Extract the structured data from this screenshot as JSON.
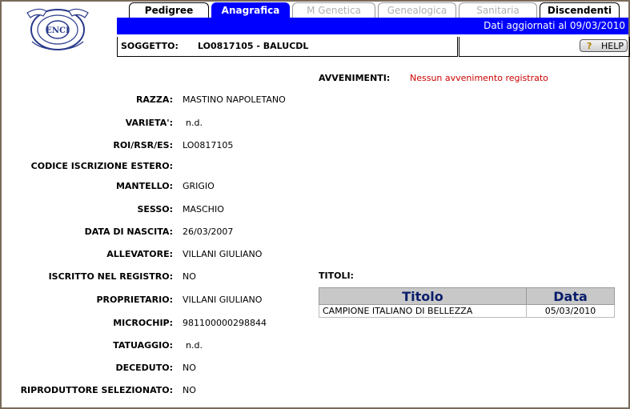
{
  "tabs": [
    {
      "label": "Pedigree",
      "state": "normal"
    },
    {
      "label": "Anagrafica",
      "state": "active"
    },
    {
      "label": "M Genetica",
      "state": "disabled"
    },
    {
      "label": "Genealogica",
      "state": "disabled"
    },
    {
      "label": "Sanitaria",
      "state": "disabled"
    },
    {
      "label": "Discendenti",
      "state": "normal"
    }
  ],
  "header": {
    "updated": "Dati aggiornati al 09/03/2010",
    "subject_label": "SOGGETTO:",
    "subject_value": "LO0817105 - BALUCDL",
    "help_label": "HELP",
    "help_icon": "question-icon"
  },
  "fields": [
    {
      "label": "RAZZA:",
      "value": "MASTINO NAPOLETANO"
    },
    {
      "label": "VARIETA':",
      "value": "n.d."
    },
    {
      "label": "ROI/RSR/ES:",
      "value": "LO0817105"
    },
    {
      "label": "CODICE ISCRIZIONE ESTERO:",
      "value": ""
    },
    {
      "label": "MANTELLO:",
      "value": "GRIGIO"
    },
    {
      "label": "SESSO:",
      "value": "MASCHIO"
    },
    {
      "label": "DATA DI NASCITA:",
      "value": "26/03/2007"
    },
    {
      "label": "ALLEVATORE:",
      "value": "VILLANI GIULIANO"
    },
    {
      "label": "ISCRITTO NEL REGISTRO:",
      "value": "NO"
    },
    {
      "label": "PROPRIETARIO:",
      "value": "VILLANI GIULIANO"
    },
    {
      "label": "MICROCHIP:",
      "value": "981100000298844"
    },
    {
      "label": "TATUAGGIO:",
      "value": "n.d."
    },
    {
      "label": "DECEDUTO:",
      "value": "NO"
    },
    {
      "label": "RIPRODUTTORE SELEZIONATO:",
      "value": "NO"
    }
  ],
  "events": {
    "label": "AVVENIMENTI:",
    "value": "Nessun avvenimento registrato"
  },
  "titles": {
    "label": "TITOLI:",
    "headers": [
      "Titolo",
      "Data"
    ],
    "rows": [
      [
        "CAMPIONE ITALIANO DI BELLEZZA",
        "05/03/2010"
      ]
    ]
  },
  "logo": {
    "text": "ENCI",
    "icon": "enci-logo"
  }
}
